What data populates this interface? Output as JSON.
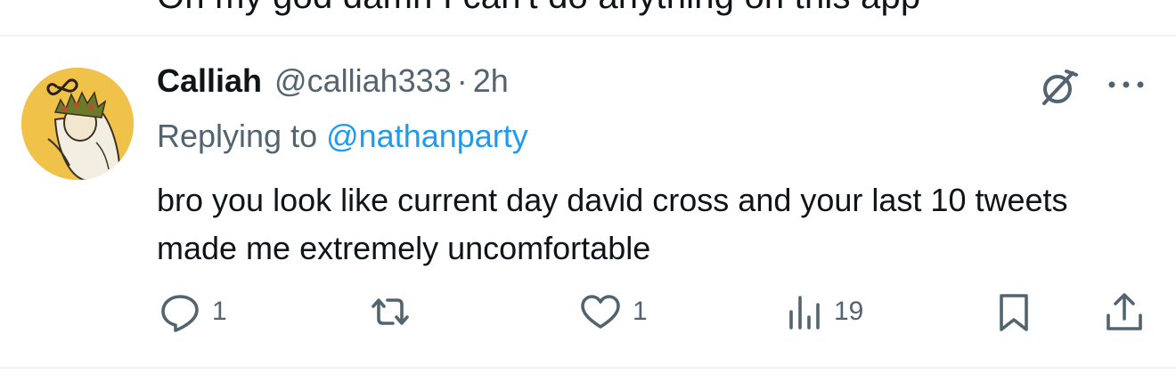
{
  "previous_tweet": {
    "text": "Oh my god damn I can't do anything on this app"
  },
  "tweet": {
    "author_name": "Calliah",
    "author_handle": "@calliah333",
    "separator": "·",
    "time": "2h",
    "replying_prefix": "Replying to ",
    "replying_to": "@nathanparty",
    "text": "bro you look like current day david cross and your last 10 tweets made me extremely uncomfortable"
  },
  "actions": {
    "replies": "1",
    "likes": "1",
    "views": "19"
  },
  "icons": {
    "grok": "grok-icon",
    "more": "more-dots-icon",
    "reply": "reply-icon",
    "retweet": "retweet-icon",
    "like": "heart-icon",
    "views": "views-icon",
    "bookmark": "bookmark-icon",
    "share": "share-icon"
  },
  "colors": {
    "text": "#0f1419",
    "secondary": "#536471",
    "link": "#1d9bf0",
    "divider": "#eff3f4",
    "avatar_bg": "#f0c24a"
  }
}
